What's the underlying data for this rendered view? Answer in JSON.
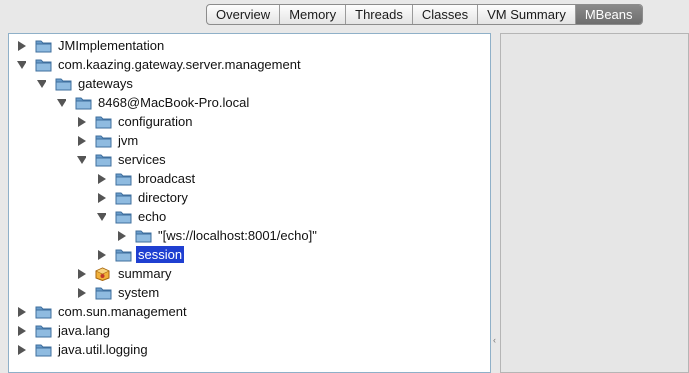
{
  "tabs": [
    {
      "label": "Overview"
    },
    {
      "label": "Memory"
    },
    {
      "label": "Threads"
    },
    {
      "label": "Classes"
    },
    {
      "label": "VM Summary"
    },
    {
      "label": "MBeans",
      "selected": true
    }
  ],
  "tree": {
    "nodes": [
      {
        "label": "JMImplementation",
        "expanded": false,
        "icon": "folder-icon"
      },
      {
        "label": "com.kaazing.gateway.server.management",
        "expanded": true,
        "icon": "folder-icon"
      },
      {
        "label": "gateways",
        "expanded": true,
        "icon": "folder-icon"
      },
      {
        "label": "8468@MacBook-Pro.local",
        "expanded": true,
        "icon": "folder-icon"
      },
      {
        "label": "configuration",
        "expanded": false,
        "icon": "folder-icon"
      },
      {
        "label": "jvm",
        "expanded": false,
        "icon": "folder-icon"
      },
      {
        "label": "services",
        "expanded": true,
        "icon": "folder-icon"
      },
      {
        "label": "broadcast",
        "expanded": false,
        "icon": "folder-icon"
      },
      {
        "label": "directory",
        "expanded": false,
        "icon": "folder-icon"
      },
      {
        "label": "echo",
        "expanded": true,
        "icon": "folder-icon"
      },
      {
        "label": "\"[ws://localhost:8001/echo]\"",
        "expanded": false,
        "icon": "folder-icon"
      },
      {
        "label": "session",
        "expanded": false,
        "icon": "folder-icon",
        "selected": true
      },
      {
        "label": "summary",
        "expanded": false,
        "icon": "mbean-icon"
      },
      {
        "label": "system",
        "expanded": false,
        "icon": "folder-icon"
      },
      {
        "label": "com.sun.management",
        "expanded": false,
        "icon": "folder-icon"
      },
      {
        "label": "java.lang",
        "expanded": false,
        "icon": "folder-icon"
      },
      {
        "label": "java.util.logging",
        "expanded": false,
        "icon": "folder-icon"
      }
    ]
  },
  "colors": {
    "selection": "#1f3fd1",
    "folder": "#5b8fbf",
    "panel_border": "#8fb0c8"
  }
}
